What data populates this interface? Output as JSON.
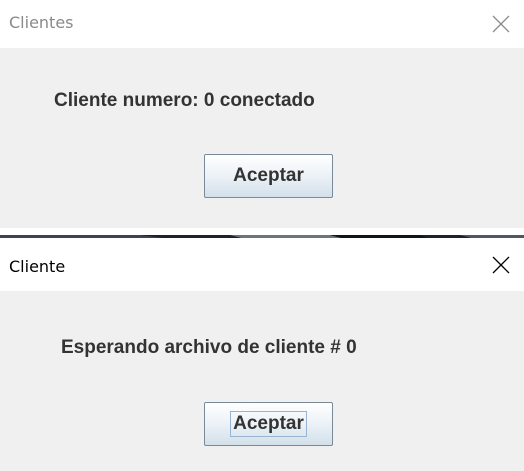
{
  "dialogs": [
    {
      "title": "Clientes",
      "title_state": "inactive",
      "message": "Cliente numero: 0 conectado",
      "button_label": "Aceptar",
      "button_focused": false
    },
    {
      "title": "Cliente",
      "title_state": "active",
      "message": "Esperando archivo de cliente # 0",
      "button_label": "Aceptar",
      "button_focused": true
    }
  ],
  "icons": {
    "close": "close-icon"
  },
  "colors": {
    "content_bg": "#f0f0f0",
    "title_inactive": "#8a8a8a",
    "title_active": "#000000",
    "message_text": "#333333",
    "button_border": "#7a8a99",
    "focus_ring": "#99b4d1"
  }
}
